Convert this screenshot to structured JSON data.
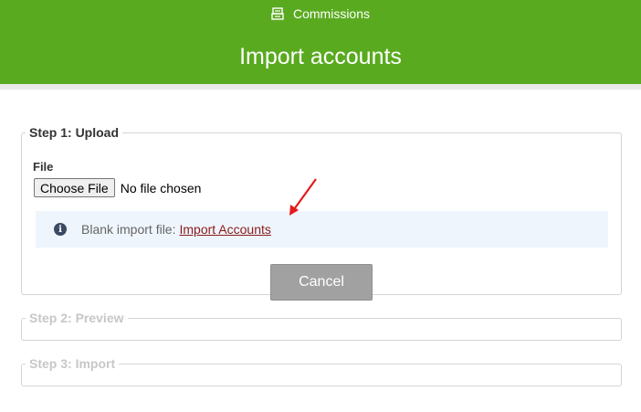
{
  "header": {
    "crumb_icon": "register-icon",
    "crumb_label": "Commissions",
    "title": "Import accounts",
    "color": "#5aaa20"
  },
  "steps": [
    {
      "legend": "Step 1: Upload",
      "active": true
    },
    {
      "legend": "Step 2: Preview",
      "active": false
    },
    {
      "legend": "Step 3: Import",
      "active": false
    }
  ],
  "upload": {
    "file_label": "File",
    "choose_button": "Choose File",
    "no_file_text": "No file chosen",
    "info_icon": "info-icon",
    "info_text": "Blank import file:",
    "info_link": "Import Accounts",
    "cancel_button": "Cancel"
  },
  "annotation": {
    "arrow_color": "#e31b1b"
  }
}
